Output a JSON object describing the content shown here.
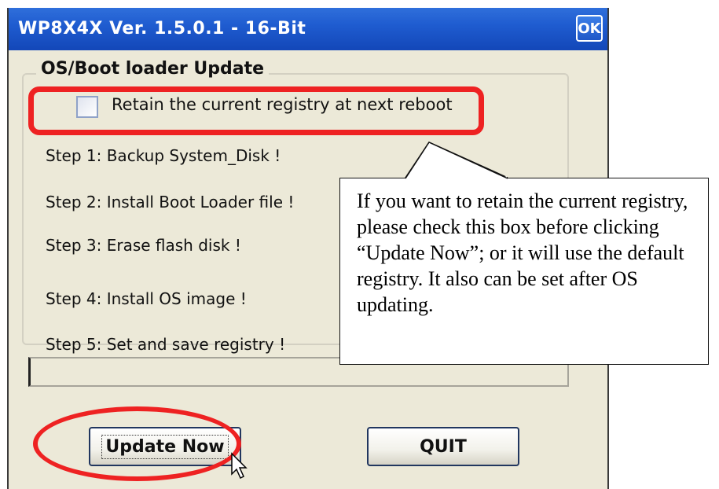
{
  "window": {
    "title": "WP8X4X Ver. 1.5.0.1 - 16-Bit",
    "ok_label": "OK"
  },
  "group": {
    "title": "OS/Boot loader Update",
    "retain_label": "Retain the current registry at next reboot",
    "retain_checked": false
  },
  "steps": [
    "Step 1: Backup System_Disk !",
    "Step 2: Install Boot Loader file !",
    "Step 3: Erase flash disk !",
    "Step 4: Install OS image !",
    "Step 5: Set and save registry !"
  ],
  "progress": 0,
  "buttons": {
    "update_label": "Update Now",
    "quit_label": "QUIT"
  },
  "callout": {
    "text": "If you want to retain the current registry, please check this box before clicking “Update Now”; or it will use the default registry. It also can be set after OS updating."
  },
  "annotation_color": "#ee2222"
}
